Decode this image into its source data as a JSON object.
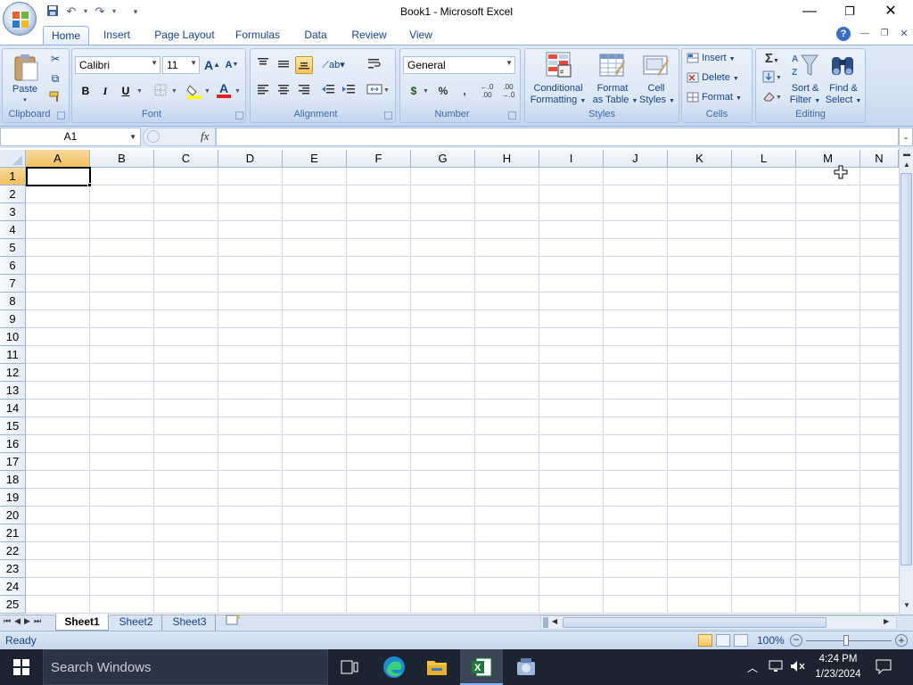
{
  "window": {
    "title": "Book1 - Microsoft Excel",
    "minimize_icon": "minimize-icon",
    "maximize_icon": "restore-icon",
    "close_icon": "close-icon"
  },
  "quick_access": [
    "save-icon",
    "undo-icon",
    "redo-icon",
    "customize-icon"
  ],
  "ribbon": {
    "tabs": [
      {
        "label": "Home",
        "active": true
      },
      {
        "label": "Insert"
      },
      {
        "label": "Page Layout"
      },
      {
        "label": "Formulas"
      },
      {
        "label": "Data"
      },
      {
        "label": "Review"
      },
      {
        "label": "View"
      }
    ],
    "groups": {
      "clipboard": {
        "label": "Clipboard",
        "paste": "Paste"
      },
      "font": {
        "label": "Font",
        "font_name": "Calibri",
        "font_size": "11",
        "bold": "B",
        "italic": "I",
        "underline": "U"
      },
      "alignment": {
        "label": "Alignment"
      },
      "number": {
        "label": "Number",
        "format": "General",
        "currency": "$",
        "percent": "%",
        "comma": ","
      },
      "styles": {
        "label": "Styles",
        "conditional": [
          "Conditional",
          "Formatting"
        ],
        "format_table": [
          "Format",
          "as Table"
        ],
        "cell_styles": [
          "Cell",
          "Styles"
        ]
      },
      "cells": {
        "label": "Cells",
        "insert": "Insert",
        "delete": "Delete",
        "format": "Format"
      },
      "editing": {
        "label": "Editing",
        "sort": [
          "Sort &",
          "Filter"
        ],
        "find": [
          "Find &",
          "Select"
        ]
      }
    },
    "accent_color": "#15428b"
  },
  "formula_bar": {
    "name_box": "A1",
    "fx": "fx",
    "formula": ""
  },
  "grid": {
    "columns": [
      "A",
      "B",
      "C",
      "D",
      "E",
      "F",
      "G",
      "H",
      "I",
      "J",
      "K",
      "L",
      "M",
      "N"
    ],
    "rows": [
      "1",
      "2",
      "3",
      "4",
      "5",
      "6",
      "7",
      "8",
      "9",
      "10",
      "11",
      "12",
      "13",
      "14",
      "15",
      "16",
      "17",
      "18",
      "19",
      "20",
      "21",
      "22",
      "23",
      "24",
      "25"
    ],
    "active_cell": "A1",
    "header_highlight_color": "#f5c96f",
    "gridline_color": "#d0d7e5"
  },
  "sheets": [
    {
      "label": "Sheet1",
      "active": true
    },
    {
      "label": "Sheet2"
    },
    {
      "label": "Sheet3"
    }
  ],
  "status": {
    "ready": "Ready",
    "zoom": "100%"
  },
  "taskbar": {
    "search_placeholder": "Search Windows",
    "time": "4:24 PM",
    "date": "1/23/2024"
  }
}
